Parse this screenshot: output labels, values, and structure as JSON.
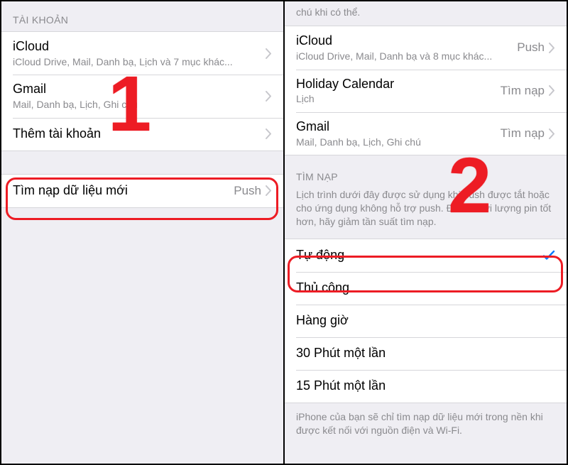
{
  "left": {
    "accounts_header": "TÀI KHOẢN",
    "accounts": [
      {
        "title": "iCloud",
        "sub": "iCloud Drive, Mail, Danh bạ, Lịch và 7 mục khác..."
      },
      {
        "title": "Gmail",
        "sub": "Mail, Danh bạ, Lịch, Ghi chú"
      }
    ],
    "add_account": "Thêm tài khoản",
    "fetch_row": {
      "title": "Tìm nạp dữ liệu mới",
      "value": "Push"
    }
  },
  "right": {
    "top_cutoff": "chú khi có thể.",
    "accounts": [
      {
        "title": "iCloud",
        "sub": "iCloud Drive, Mail, Danh bạ và 8 mục khác...",
        "value": "Push"
      },
      {
        "title": "Holiday Calendar",
        "sub": "Lịch",
        "value": "Tìm nạp"
      },
      {
        "title": "Gmail",
        "sub": "Mail, Danh bạ, Lịch, Ghi chú",
        "value": "Tìm nạp"
      }
    ],
    "fetch_header": "TÌM NẠP",
    "fetch_desc": "Lịch trình dưới đây được sử dụng khi push được tắt hoặc cho ứng dụng không hỗ trợ push. Để có thời lượng pin tốt hơn, hãy giảm tần suất tìm nạp.",
    "options": [
      {
        "label": "Tự động",
        "selected": true
      },
      {
        "label": "Thủ công",
        "selected": false
      },
      {
        "label": "Hàng giờ",
        "selected": false
      },
      {
        "label": "30 Phút một lần",
        "selected": false
      },
      {
        "label": "15 Phút một lần",
        "selected": false
      }
    ],
    "bottom_note": "iPhone của bạn sẽ chỉ tìm nạp dữ liệu mới trong nền khi được kết nối với nguồn điện và Wi-Fi."
  },
  "annotations": {
    "step1": "1",
    "step2": "2"
  }
}
